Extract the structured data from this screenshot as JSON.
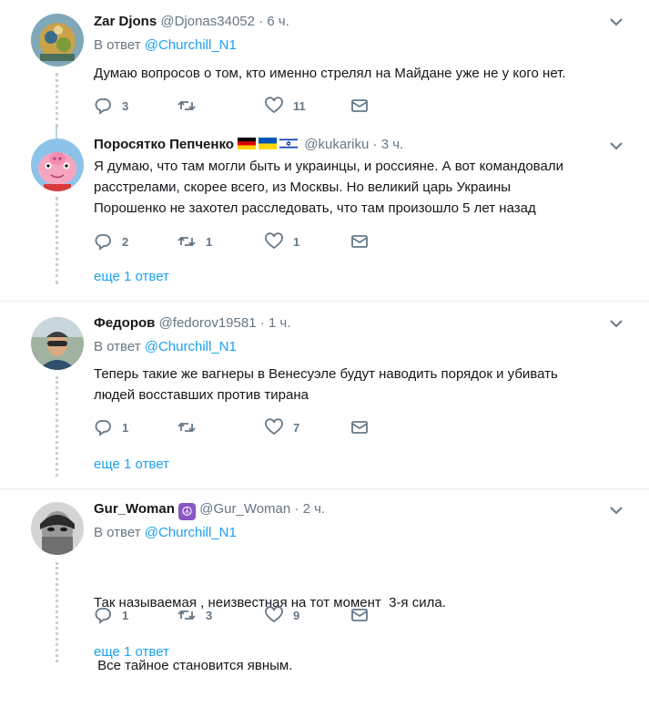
{
  "tweets": [
    {
      "name": "Zar Djons",
      "handle": "@Djonas34052",
      "time": "6 ч.",
      "reply_prefix": "В ответ",
      "reply_to": "@Churchill_N1",
      "lines": [
        "Думаю вопросов о том, кто именно стрелял на Майдане уже не у кого нет."
      ],
      "replies": "3",
      "retweets": "",
      "likes": "11",
      "more": ""
    },
    {
      "name": "Поросятко Пепченко",
      "handle": "@kukariku",
      "time": "3 ч.",
      "reply_prefix": "",
      "reply_to": "",
      "lines": [
        "Я думаю, что там могли быть и украинцы, и россияне. А вот командовали",
        "расстрелами, скорее всего, из Москвы. Но великий царь Украины",
        "Порошенко не захотел расследовать, что там произошло 5 лет назад"
      ],
      "replies": "2",
      "retweets": "1",
      "likes": "1",
      "more": "еще 1 ответ"
    },
    {
      "name": "Федоров",
      "handle": "@fedorov19581",
      "time": "1 ч.",
      "reply_prefix": "В ответ",
      "reply_to": "@Churchill_N1",
      "lines": [
        "Теперь такие же вагнеры в Венесуэле будут наводить порядок и убивать",
        "людей восставших против тирана"
      ],
      "replies": "1",
      "retweets": "",
      "likes": "7",
      "more": "еще 1 ответ"
    },
    {
      "name": "Gur_Woman",
      "name_badge": "☮",
      "handle": "@Gur_Woman",
      "time": "2 ч.",
      "reply_prefix": "В ответ",
      "reply_to": "@Churchill_N1",
      "lines": [
        "Так называемая , неизвестная на тот момент  3-я сила.",
        " Все тайное становится явным."
      ],
      "replies": "1",
      "retweets": "3",
      "likes": "9",
      "more": "еще 1 ответ"
    }
  ],
  "dot": "·",
  "colors": {
    "link": "#1da1f2",
    "muted": "#657786",
    "separator": "#e6ecf0"
  },
  "icons": [
    "reply-icon",
    "retweet-icon",
    "like-icon",
    "message-icon",
    "chevron-down-icon"
  ]
}
